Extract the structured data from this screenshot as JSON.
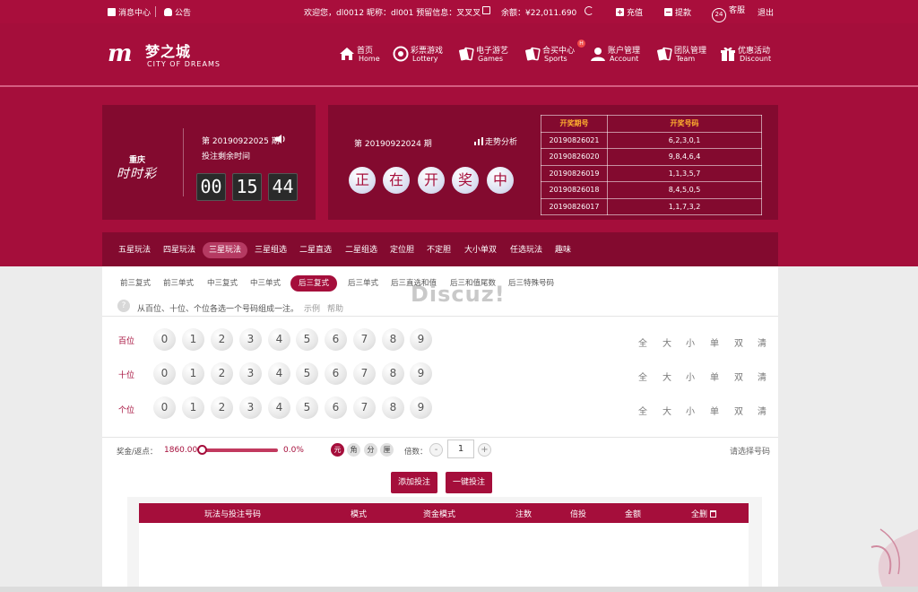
{
  "topbar": {
    "messages": "消息中心",
    "notice": "公告",
    "greeting": "欢迎您，dl0012 昵称：dl001 预留信息：叉叉叉",
    "balance_label": "余额：",
    "balance": "¥22,011.690",
    "recharge": "充值",
    "withdraw": "提款",
    "service_badge": "24",
    "service": "客服",
    "logout": "退出"
  },
  "brand": {
    "mark": "m",
    "cn": "梦之城",
    "en": "CITY OF DREAMS"
  },
  "nav": [
    {
      "cn": "首页",
      "en": "Home",
      "icon": "home-icon"
    },
    {
      "cn": "彩票游戏",
      "en": "Lottery",
      "icon": "lottery-icon"
    },
    {
      "cn": "电子游艺",
      "en": "Games",
      "icon": "cards-icon"
    },
    {
      "cn": "合买中心",
      "en": "Sports",
      "icon": "cards-icon",
      "badge": "H"
    },
    {
      "cn": "账户管理",
      "en": "Account",
      "icon": "user-icon"
    },
    {
      "cn": "团队管理",
      "en": "Team",
      "icon": "cards-icon"
    },
    {
      "cn": "优惠活动",
      "en": "Discount",
      "icon": "gift-icon"
    }
  ],
  "lottery": {
    "name_cn": "重庆",
    "name_style": "时时彩",
    "current_issue": "第 20190922025 期",
    "remain_label": "投注剩余时间",
    "countdown": [
      "00",
      "15",
      "44"
    ],
    "prev_issue": "第 20190922024 期",
    "trend": "走势分析",
    "status": [
      "正",
      "在",
      "开",
      "奖",
      "中"
    ]
  },
  "history": {
    "headers": [
      "开奖期号",
      "开奖号码"
    ],
    "rows": [
      [
        "20190826021",
        "6,2,3,0,1"
      ],
      [
        "20190826020",
        "9,8,4,6,4"
      ],
      [
        "20190826019",
        "1,1,3,5,7"
      ],
      [
        "20190826018",
        "8,4,5,0,5"
      ],
      [
        "20190826017",
        "1,1,7,3,2"
      ]
    ]
  },
  "play_tabs": [
    "五星玩法",
    "四星玩法",
    "三星玩法",
    "三星组选",
    "二星直选",
    "二星组选",
    "定位胆",
    "不定胆",
    "大小单双",
    "任选玩法",
    "趣味"
  ],
  "sub_tabs": [
    "前三复式",
    "前三单式",
    "中三复式",
    "中三单式",
    "后三复式",
    "后三单式",
    "后三直选和值",
    "后三和值尾数",
    "后三特殊号码"
  ],
  "tip": {
    "icon": "?",
    "text": "从百位、十位、个位各选一个号码组成一注。",
    "example": "示例",
    "help": "帮助"
  },
  "positions": [
    "百位",
    "十位",
    "个位"
  ],
  "digits": [
    "0",
    "1",
    "2",
    "3",
    "4",
    "5",
    "6",
    "7",
    "8",
    "9"
  ],
  "quick_select": [
    "全",
    "大",
    "小",
    "单",
    "双",
    "清"
  ],
  "bonus": {
    "label": "奖金/返点：",
    "value": "1860.00",
    "rebate": "0.0%",
    "slider_fraction": 0.0
  },
  "units": [
    "元",
    "角",
    "分",
    "厘"
  ],
  "multiplier": {
    "label": "倍数：",
    "minus": "-",
    "value": "1",
    "plus": "+"
  },
  "select_hint": "请选择号码",
  "buttons": {
    "add": "添加投注",
    "oneclick": "一键投注"
  },
  "bet_table": {
    "headers": [
      "玩法与投注号码",
      "模式",
      "资金模式",
      "注数",
      "倍投",
      "金额",
      "全删"
    ]
  },
  "watermark": "Discuz!",
  "colors": {
    "brand": "#a50e3b",
    "panel": "#830a2f",
    "accent": "#ffb02e"
  }
}
